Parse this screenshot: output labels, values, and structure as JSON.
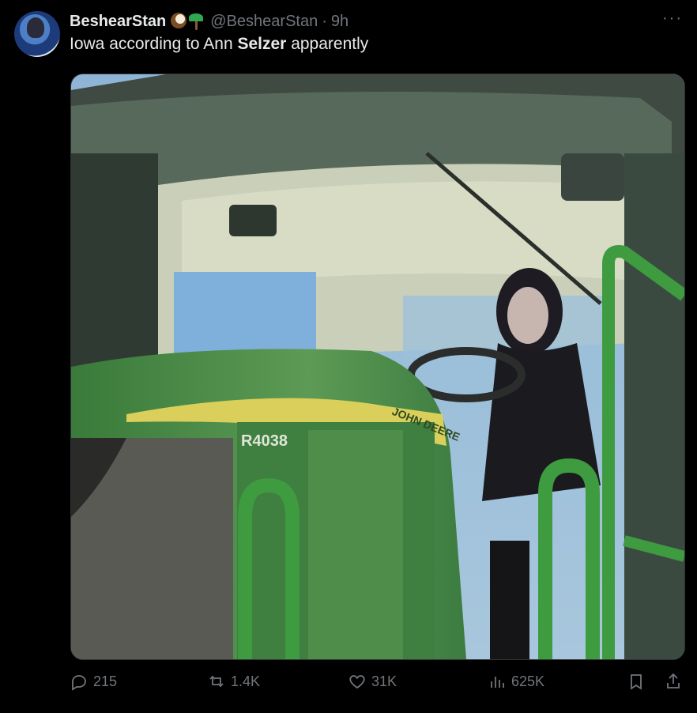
{
  "tweet": {
    "display_name": "BeshearStan",
    "handle": "@BeshearStan",
    "separator": "·",
    "time": "9h",
    "text_before": "Iowa according to Ann ",
    "text_bold": "Selzer",
    "text_after": " apparently",
    "more_label": "···"
  },
  "media": {
    "model_badge": "R4038",
    "brand_stripe": "JOHN DEERE"
  },
  "actions": {
    "replies": "215",
    "reposts": "1.4K",
    "likes": "31K",
    "views": "625K"
  },
  "colors": {
    "background": "#000000",
    "secondary_text": "#71767b",
    "primary_text": "#e7e9ea",
    "tractor_green": "#3d8a3d",
    "stripe_yellow": "#d9cf5a"
  }
}
